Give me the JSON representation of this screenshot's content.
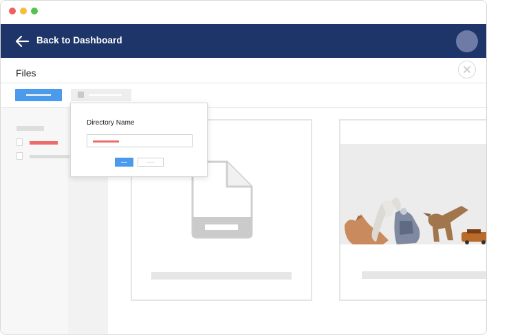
{
  "header": {
    "back_label": "Back to Dashboard",
    "back_icon": "arrow-left-icon",
    "avatar_icon": "user-avatar"
  },
  "files": {
    "title": "Files",
    "close_icon": "close-icon"
  },
  "dialog": {
    "label": "Directory Name"
  },
  "colors": {
    "appbar": "#1e3569",
    "primary": "#4c9aec",
    "accent_red": "#ee6b6b",
    "avatar": "#6d7ba5"
  },
  "cards": [
    {
      "type": "document-thumbnail",
      "icon": "document-icon"
    },
    {
      "type": "image-thumbnail",
      "icon": "photo-of-toys"
    }
  ]
}
